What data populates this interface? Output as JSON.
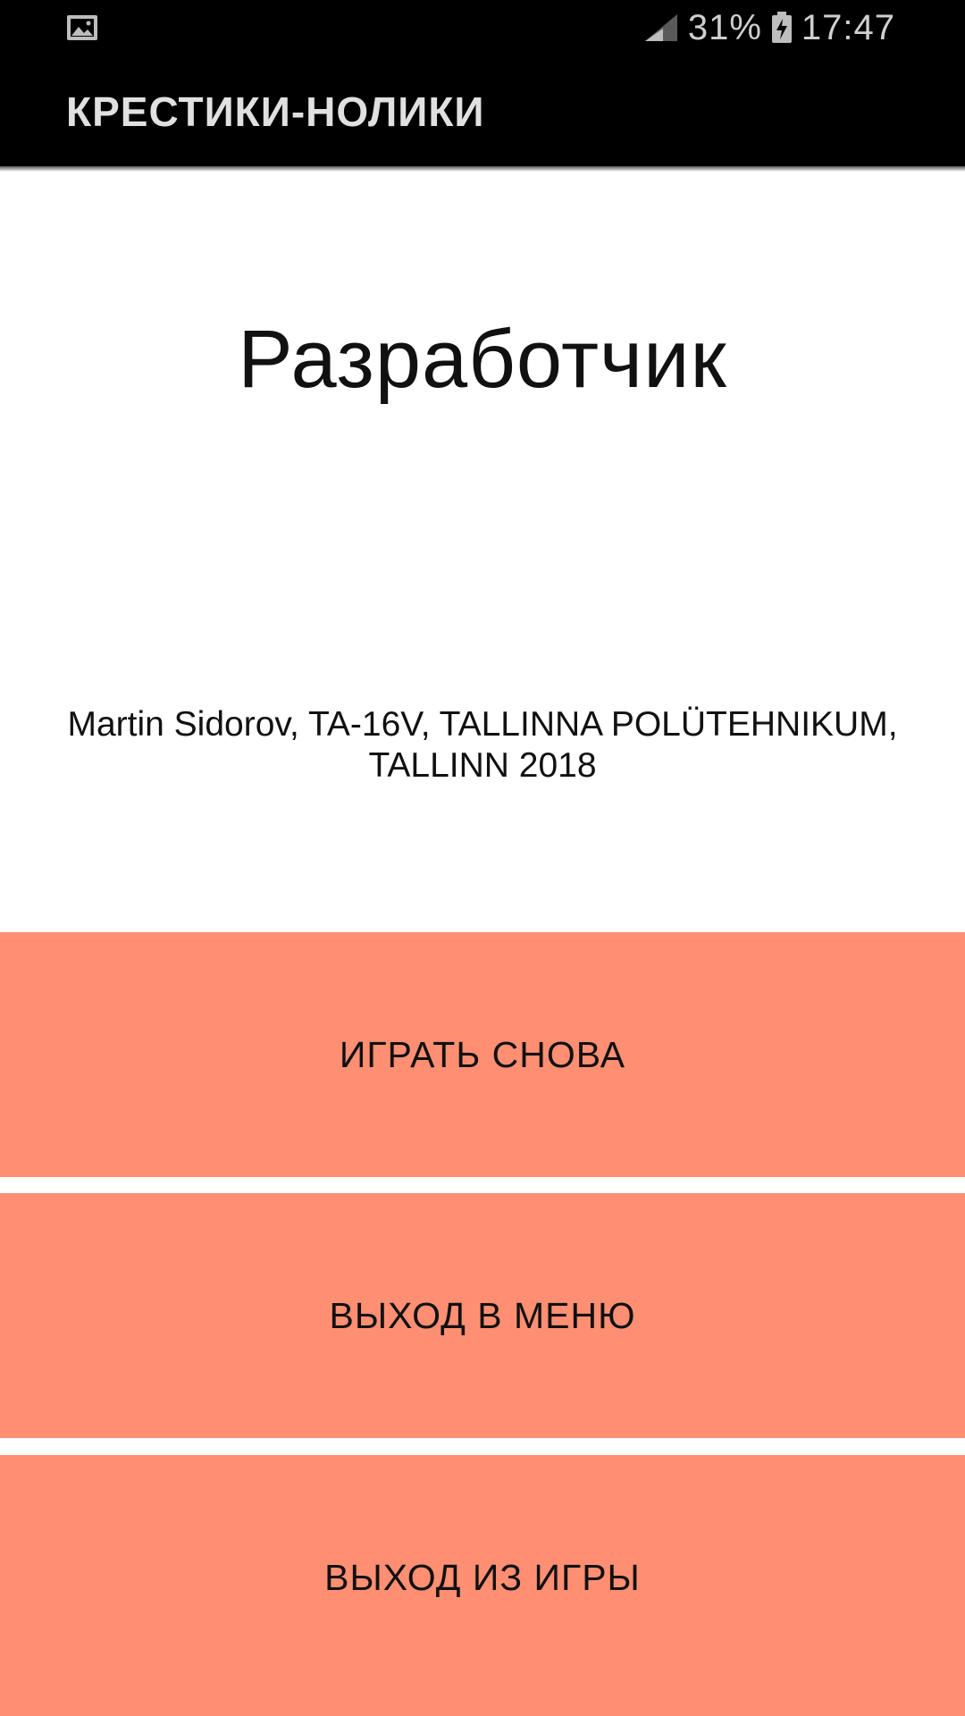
{
  "status_bar": {
    "battery": "31%",
    "time": "17:47",
    "icons": [
      "gallery-icon",
      "signal-icon",
      "battery-charging-icon"
    ]
  },
  "app_bar": {
    "title": "КРЕСТИКИ-НОЛИКИ"
  },
  "main": {
    "title": "Разработчик",
    "credits": "Martin Sidorov, TA-16V, TALLINNA POLÜTEHNIKUM, TALLINN 2018"
  },
  "buttons": {
    "play_again": "ИГРАТЬ СНОВА",
    "exit_menu": "ВЫХОД В МЕНЮ",
    "exit_game": "ВЫХОД ИЗ ИГРЫ"
  },
  "colors": {
    "button_bg": "#ff8f73",
    "bar_bg": "#000000"
  }
}
